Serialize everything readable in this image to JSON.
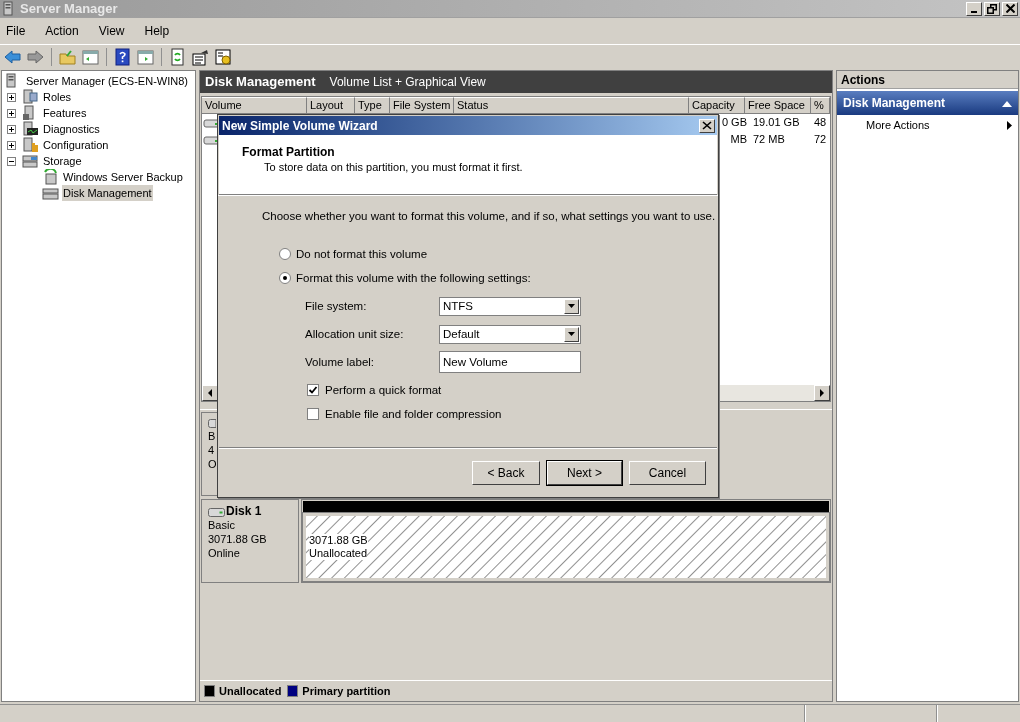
{
  "window": {
    "title": "Server Manager"
  },
  "menu": [
    {
      "label": "File"
    },
    {
      "label": "Action"
    },
    {
      "label": "View"
    },
    {
      "label": "Help"
    }
  ],
  "tree": {
    "label": "Server Manager (ECS-EN-WIN8)",
    "selected": false,
    "children": [
      {
        "label": "Roles",
        "expanded": false,
        "selected": false
      },
      {
        "label": "Features",
        "expanded": false,
        "selected": false
      },
      {
        "label": "Diagnostics",
        "expanded": false,
        "selected": false
      },
      {
        "label": "Configuration",
        "expanded": false,
        "selected": false
      },
      {
        "label": "Storage",
        "expanded": true,
        "selected": false,
        "children": [
          {
            "label": "Windows Server Backup",
            "selected": false
          },
          {
            "label": "Disk Management",
            "selected": true
          }
        ]
      }
    ]
  },
  "center": {
    "title": "Disk Management",
    "subtitle": "Volume List + Graphical View",
    "columns": [
      "Volume",
      "Layout",
      "Type",
      "File System",
      "Status",
      "Capacity",
      "Free Space",
      "%"
    ],
    "rows": [
      {
        "capacity": "0 GB",
        "free_space": "19.01 GB",
        "percent": "48"
      },
      {
        "capacity": "MB",
        "free_space": "72 MB",
        "percent": "72"
      }
    ],
    "disks": [
      {
        "type": "B",
        "size": "4",
        "status": "O"
      },
      {
        "name": "Disk 1",
        "type": "Basic",
        "size": "3071.88 GB",
        "status": "Online",
        "partitions": [
          {
            "kind": "unallocated",
            "size": "3071.88 GB",
            "label": "Unallocated"
          }
        ]
      }
    ],
    "legend": [
      {
        "label": "Unallocated",
        "color": "#000000"
      },
      {
        "label": "Primary partition",
        "color": "#000080"
      }
    ]
  },
  "actions": {
    "title": "Actions",
    "section": "Disk Management",
    "items": [
      {
        "label": "More Actions"
      }
    ]
  },
  "dialog": {
    "title": "New Simple Volume Wizard",
    "heading": "Format Partition",
    "subheading": "To store data on this partition, you must format it first.",
    "prompt": "Choose whether you want to format this volume, and if so, what settings you want to use.",
    "options": [
      {
        "label": "Do not format this volume",
        "selected": false
      },
      {
        "label": "Format this volume with the following settings:",
        "selected": true
      }
    ],
    "fields": [
      {
        "label": "File system:",
        "kind": "select",
        "value": "NTFS"
      },
      {
        "label": "Allocation unit size:",
        "kind": "select",
        "value": "Default"
      },
      {
        "label": "Volume label:",
        "kind": "text",
        "value": "New Volume"
      }
    ],
    "checkboxes": [
      {
        "label": "Perform a quick format",
        "checked": true
      },
      {
        "label": "Enable file and folder compression",
        "checked": false
      }
    ],
    "buttons": [
      {
        "label": "< Back",
        "default": false
      },
      {
        "label": "Next >",
        "default": true
      },
      {
        "label": "Cancel",
        "default": false
      }
    ]
  }
}
